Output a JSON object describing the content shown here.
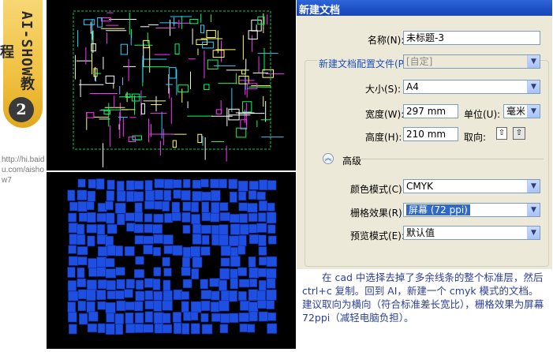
{
  "badge": {
    "title": "AI-SHOW教程",
    "step": "2",
    "url": "http://hi.baidu.com/aishow7"
  },
  "images": {
    "top": {
      "icon": "cad-floorplan-lines"
    },
    "bottom": {
      "icon": "cad-floorplan-blue-fill"
    }
  },
  "dialog": {
    "title": "新建文档",
    "name": {
      "label": "名称(N):",
      "value": "未标题-3"
    },
    "profile": {
      "label": "新建文档配置文件(P):",
      "value": "[自定]"
    },
    "size": {
      "label": "大小(S):",
      "value": "A4"
    },
    "width": {
      "label": "宽度(W):",
      "value": "297 mm"
    },
    "unit": {
      "label": "单位(U):",
      "value": "毫米"
    },
    "height": {
      "label": "高度(H):",
      "value": "210 mm"
    },
    "orientation": {
      "label": "取向:",
      "portrait_icon": "portrait-orientation-icon",
      "landscape_icon": "landscape-orientation-icon"
    },
    "advanced": {
      "label": "高级"
    },
    "color_mode": {
      "label": "颜色模式(C):",
      "value": "CMYK"
    },
    "raster": {
      "label": "栅格效果(R):",
      "value": "屏幕 (72 ppi)"
    },
    "preview": {
      "label": "预览模式(E):",
      "value": "默认值"
    }
  },
  "note": "在 cad 中选择去掉了多余线条的整个标准层，然后 ctrl+c 复制。回到 AI，新建一个 cmyk 模式的文档。建议取向为横向（符合标准差长宽比），栅格效果为屏幕 72ppi（减轻电脑负担）。"
}
